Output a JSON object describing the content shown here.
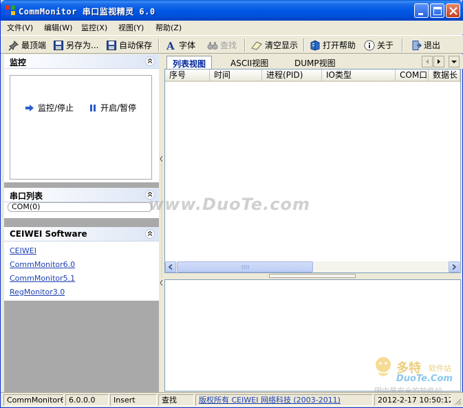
{
  "window": {
    "title": "CommMonitor 串口监视精灵 6.0",
    "controls": {
      "minimize": "minimize",
      "maximize": "maximize",
      "close": "close"
    }
  },
  "menu": [
    {
      "label": "文件(V)"
    },
    {
      "label": "编辑(W)"
    },
    {
      "label": "监控(X)"
    },
    {
      "label": "视图(Y)"
    },
    {
      "label": "帮助(Z)"
    }
  ],
  "toolbar": {
    "topmost": "最顶端",
    "save_as": "另存为...",
    "auto_save": "自动保存",
    "font": "字体",
    "find": "查找",
    "clear": "清空显示",
    "open_help": "打开帮助",
    "about": "关于",
    "exit": "退出"
  },
  "left_panel": {
    "monitor_group": {
      "title": "监控",
      "monitor_stop": "监控/停止",
      "start_pause": "开启/暂停"
    },
    "port_group": {
      "title": "串口列表",
      "ports": [
        "COM(0)"
      ]
    },
    "links_group": {
      "title": "CEIWEI Software",
      "links": [
        "CEIWEI",
        "CommMonitor6.0",
        "CommMonitor5.1",
        "RegMonitor3.0"
      ]
    }
  },
  "tabs": [
    {
      "label": "列表视图",
      "active": true
    },
    {
      "label": "ASCII视图",
      "active": false
    },
    {
      "label": "DUMP视图",
      "active": false
    }
  ],
  "columns": [
    "序号",
    "时间",
    "进程(PID)",
    "IO类型",
    "COM口",
    "数据长"
  ],
  "status": {
    "app": "CommMonitor6",
    "version": "6.0.0.0",
    "mode": "Insert",
    "find": "查找",
    "copyright": "版权所有 CEIWEI 网络科技 (2003-2011)",
    "datetime": "2012-2-17 10:50:12"
  },
  "watermark": {
    "text": "www.DuoTe.com",
    "cn": "多特",
    "cn_small": "软件站",
    "en": "DuoTe.Com",
    "slogan": "国内最安全的软件站"
  },
  "colors": {
    "titlebar": "#0058e6",
    "link": "#1c3fb0",
    "active_tab_text": "#00279c",
    "window_bg": "#ece9d8"
  }
}
